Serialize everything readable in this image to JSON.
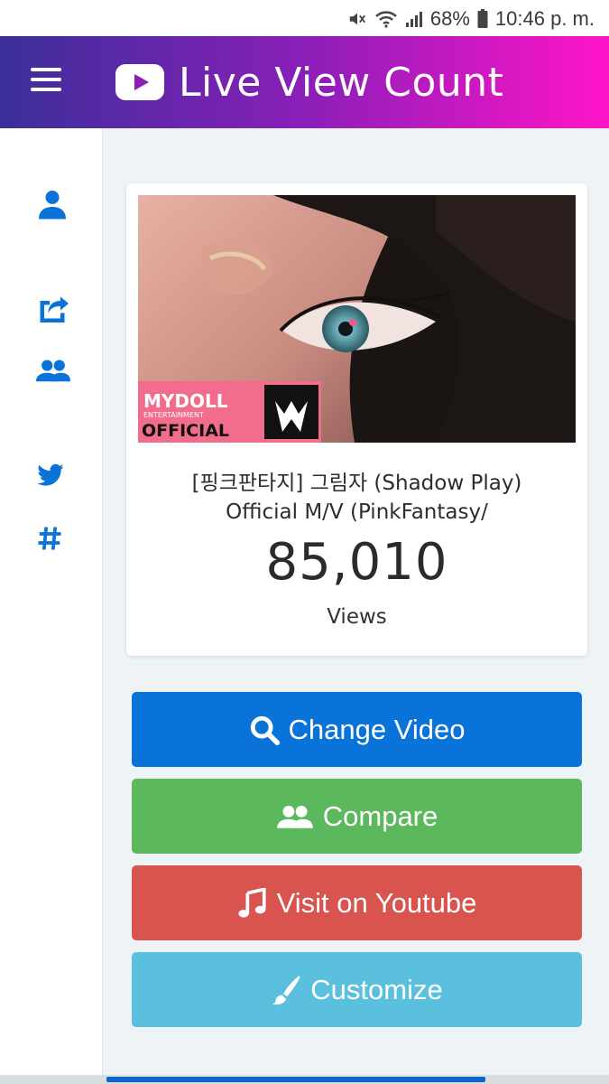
{
  "status_bar": {
    "battery": "68%",
    "time": "10:46 p. m."
  },
  "header": {
    "title": "Live View Count",
    "logo_icon": "youtube-play-icon",
    "menu_icon": "hamburger-menu-icon"
  },
  "sidebar": {
    "items": [
      {
        "icon": "user-icon"
      },
      {
        "icon": "share-icon"
      },
      {
        "icon": "users-icon"
      },
      {
        "icon": "twitter-icon"
      },
      {
        "icon": "hashtag-icon"
      }
    ]
  },
  "video": {
    "thumbnail_logo_text": "MYDOLL",
    "thumbnail_logo_subtext": "ENTERTAINMENT",
    "thumbnail_logo_official": "OFFICIAL",
    "title_line1": "[핑크판타지] 그림자 (Shadow Play)",
    "title_line2": "Official M/V (PinkFantasy/",
    "view_count": "85,010",
    "views_label": "Views"
  },
  "buttons": {
    "change_video": "Change Video",
    "compare": "Compare",
    "visit_youtube": "Visit on Youtube",
    "customize": "Customize"
  },
  "colors": {
    "accent_blue": "#0a73d9",
    "green": "#5cb85c",
    "red": "#d9534f",
    "light_blue": "#5bc0de",
    "header_gradient_start": "#3b2f9a",
    "header_gradient_end": "#ff14c8"
  }
}
